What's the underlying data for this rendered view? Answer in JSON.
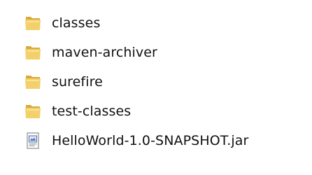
{
  "explorer": {
    "items": [
      {
        "name": "classes",
        "type": "folder",
        "icon": "folder-icon"
      },
      {
        "name": "maven-archiver",
        "type": "folder",
        "icon": "folder-icon"
      },
      {
        "name": "surefire",
        "type": "folder",
        "icon": "folder-icon"
      },
      {
        "name": "test-classes",
        "type": "folder",
        "icon": "folder-icon"
      },
      {
        "name": "HelloWorld-1.0-SNAPSHOT.jar",
        "type": "file",
        "icon": "jar-file-icon"
      }
    ]
  },
  "colors": {
    "folder_back": "#d9a93a",
    "folder_front": "#f3d06b",
    "folder_highlight": "#fbe7a2",
    "jar_paper": "#ffffff",
    "jar_border": "#8c8c8c",
    "jar_accent": "#4a6fae"
  }
}
